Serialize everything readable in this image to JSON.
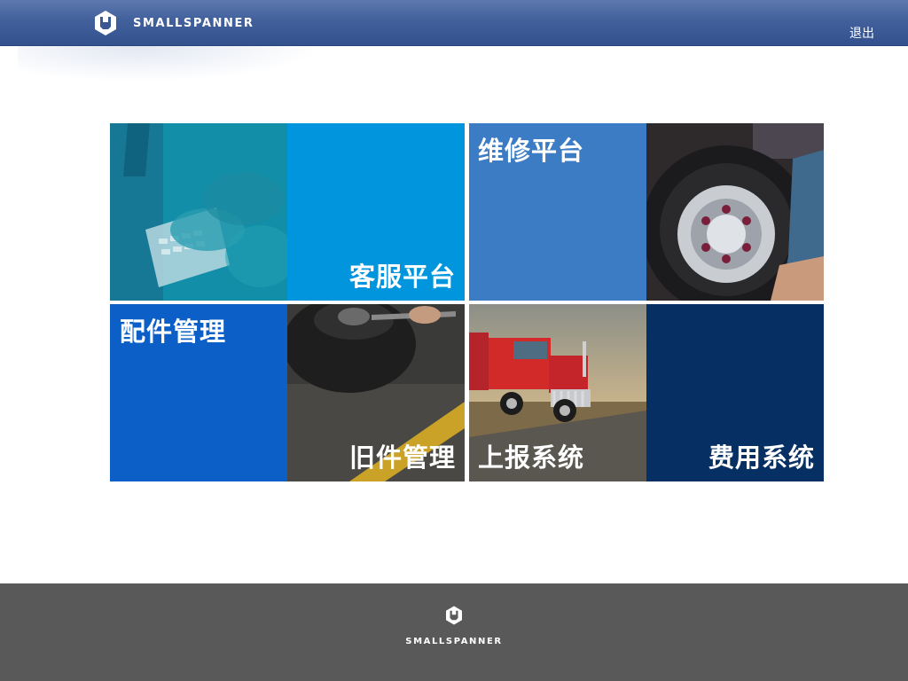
{
  "header": {
    "brand": "SMALLSPANNER",
    "logout_label": "退出"
  },
  "tiles": [
    {
      "label": "客服平台",
      "color": "#0095dd"
    },
    {
      "label": "维修平台",
      "color": "#3b7cc4"
    },
    {
      "label": "配件管理",
      "color": "#0d5fc8"
    },
    {
      "label": "旧件管理"
    },
    {
      "label": "上报系统"
    },
    {
      "label": "费用系统",
      "color": "#062f63"
    }
  ],
  "footer": {
    "brand": "SMALLSPANNER"
  }
}
